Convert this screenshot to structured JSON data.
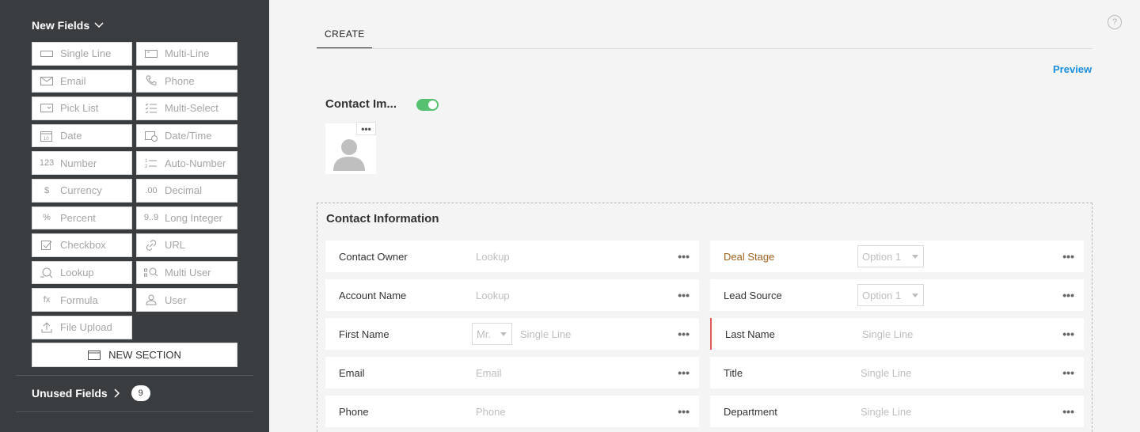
{
  "sidebar": {
    "title": "New Fields",
    "fields": [
      {
        "label": "Single Line",
        "icon": "single-line-icon"
      },
      {
        "label": "Multi-Line",
        "icon": "multi-line-icon"
      },
      {
        "label": "Email",
        "icon": "email-icon"
      },
      {
        "label": "Phone",
        "icon": "phone-icon"
      },
      {
        "label": "Pick List",
        "icon": "pick-list-icon"
      },
      {
        "label": "Multi-Select",
        "icon": "multi-select-icon"
      },
      {
        "label": "Date",
        "icon": "date-icon",
        "glyph": "10"
      },
      {
        "label": "Date/Time",
        "icon": "date-time-icon"
      },
      {
        "label": "Number",
        "icon": "number-icon",
        "glyph": "123"
      },
      {
        "label": "Auto-Number",
        "icon": "auto-number-icon"
      },
      {
        "label": "Currency",
        "icon": "currency-icon",
        "glyph": "$"
      },
      {
        "label": "Decimal",
        "icon": "decimal-icon",
        "glyph": ".00"
      },
      {
        "label": "Percent",
        "icon": "percent-icon",
        "glyph": "%"
      },
      {
        "label": "Long Integer",
        "icon": "long-integer-icon",
        "glyph": "9..9"
      },
      {
        "label": "Checkbox",
        "icon": "checkbox-icon"
      },
      {
        "label": "URL",
        "icon": "url-icon"
      },
      {
        "label": "Lookup",
        "icon": "lookup-icon"
      },
      {
        "label": "Multi User",
        "icon": "multi-user-icon"
      },
      {
        "label": "Formula",
        "icon": "formula-icon",
        "glyph": "fx"
      },
      {
        "label": "User",
        "icon": "user-icon"
      },
      {
        "label": "File Upload",
        "icon": "file-upload-icon"
      }
    ],
    "new_section_label": "NEW SECTION",
    "unused_label": "Unused Fields",
    "unused_count": "9"
  },
  "main": {
    "tab_label": "CREATE",
    "preview_label": "Preview",
    "layout_name": "Contact Im...",
    "toggle_on": true,
    "photo_more": "•••",
    "section_title": "Contact Information",
    "left_fields": [
      {
        "label": "Contact Owner",
        "placeholder": "Lookup"
      },
      {
        "label": "Account Name",
        "placeholder": "Lookup"
      },
      {
        "label": "First Name",
        "salutation": "Mr.",
        "placeholder": "Single Line"
      },
      {
        "label": "Email",
        "placeholder": "Email"
      },
      {
        "label": "Phone",
        "placeholder": "Phone"
      }
    ],
    "right_fields": [
      {
        "label": "Deal Stage",
        "select": "Option 1"
      },
      {
        "label": "Lead Source",
        "select": "Option 1"
      },
      {
        "label": "Last Name",
        "placeholder": "Single Line",
        "mandatory": true
      },
      {
        "label": "Title",
        "placeholder": "Single Line"
      },
      {
        "label": "Department",
        "placeholder": "Single Line"
      }
    ],
    "more_glyph": "•••"
  },
  "colors": {
    "sidebar_bg": "#3a3d40",
    "accent_link": "#1a8fe0",
    "toggle_on": "#56c271",
    "deal_stage_label": "#a0621d",
    "mandatory_bar": "#e05a5a"
  }
}
